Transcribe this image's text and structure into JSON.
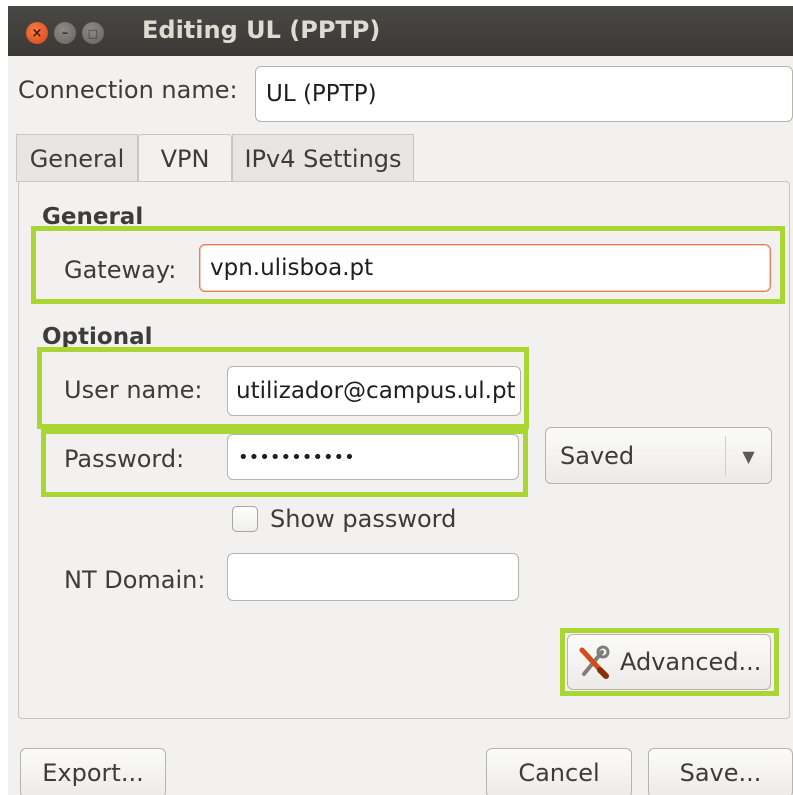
{
  "window": {
    "title": "Editing UL (PPTP)",
    "close_glyph": "×",
    "minimize_glyph": "–",
    "maximize_glyph": "□"
  },
  "connection": {
    "label": "Connection name:",
    "value": "UL (PPTP)"
  },
  "tabs": [
    {
      "label": "General",
      "active": false
    },
    {
      "label": "VPN",
      "active": true
    },
    {
      "label": "IPv4 Settings",
      "active": false
    }
  ],
  "vpn": {
    "general_heading": "General",
    "gateway_label": "Gateway:",
    "gateway_value": "vpn.ulisboa.pt",
    "optional_heading": "Optional",
    "username_label": "User name:",
    "username_value": "utilizador@campus.ul.pt",
    "password_label": "Password:",
    "password_value": "•••••••••••",
    "password_storage": "Saved",
    "password_storage_arrow": "▼",
    "show_password_label": "Show password",
    "show_password_checked": false,
    "ntdomain_label": "NT Domain:",
    "ntdomain_value": "",
    "advanced_label": "Advanced...",
    "advanced_icon": "tools-icon"
  },
  "footer": {
    "export_label": "Export...",
    "cancel_label": "Cancel",
    "save_label": "Save..."
  },
  "colors": {
    "highlight": "#a9d632",
    "titlebar": "#3c3b37",
    "close_button": "#e9541b"
  }
}
